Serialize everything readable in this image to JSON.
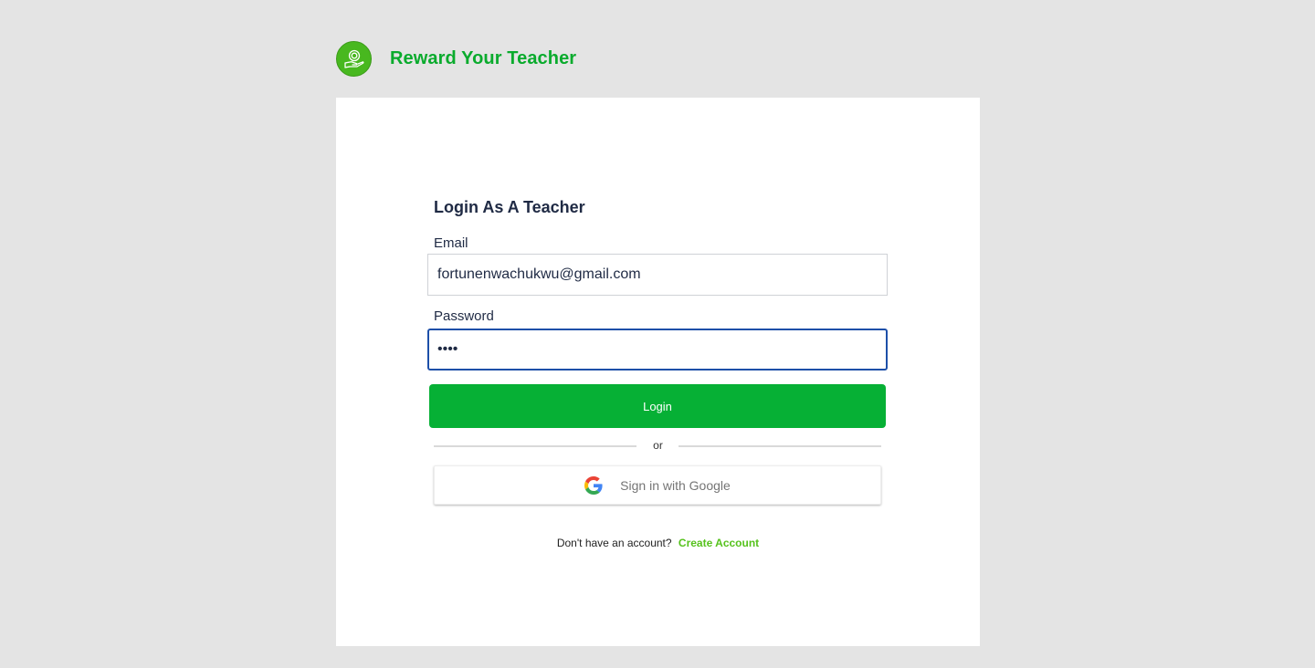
{
  "brand": {
    "name": "Reward Your Teacher",
    "logo_icon": "hand-coin-icon",
    "color": "#0aab2d"
  },
  "form": {
    "title": "Login As A Teacher",
    "email": {
      "label": "Email",
      "value": "fortunenwachukwu@gmail.com"
    },
    "password": {
      "label": "Password",
      "value": "••••"
    },
    "login_button": "Login",
    "divider_text": "or",
    "google_button": {
      "label": "Sign in with Google",
      "icon": "google-icon"
    },
    "signup": {
      "prompt": "Don't have an account?",
      "link": "Create Account"
    }
  },
  "colors": {
    "accent": "#06b035",
    "link": "#56c21d",
    "focus_border": "#1d4fa8",
    "background": "#e4e4e4"
  }
}
